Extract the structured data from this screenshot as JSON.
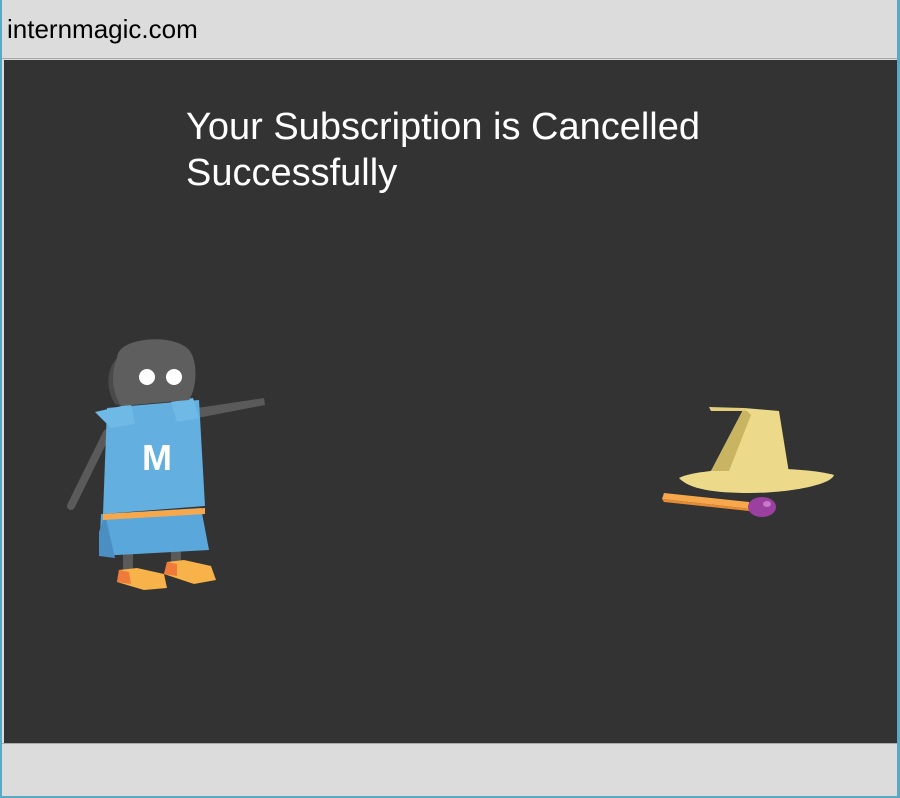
{
  "window": {
    "site_name": "internmagic.com"
  },
  "main": {
    "headline": "Your Subscription is Cancelled Successfully",
    "mascot": {
      "shirt_letter": "M",
      "icon": "mascot-character-icon"
    },
    "hat": {
      "icon": "wizard-hat-icon"
    }
  },
  "colors": {
    "page_background": "#333333",
    "chrome_background": "#dcdcdc",
    "headline_text": "#ffffff",
    "mascot_shirt": "#62afe0",
    "mascot_head": "#5e5e5e",
    "shoe": "#f7b24a",
    "hat": "#ecd98a",
    "wand": "#f7a84d",
    "gem": "#9b3fa0"
  }
}
